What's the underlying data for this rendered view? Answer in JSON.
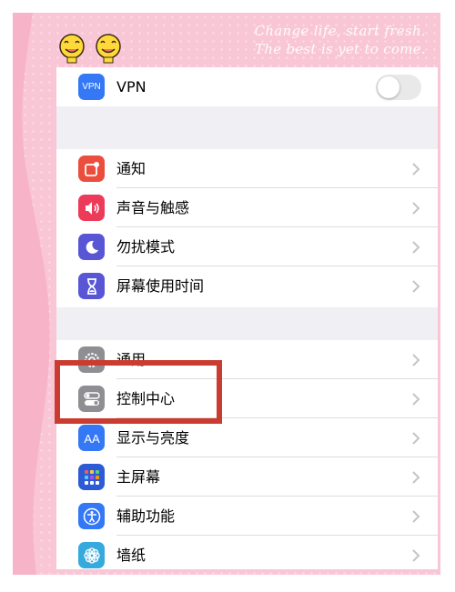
{
  "decoration": {
    "tagline_line1": "Change life, start fresh.",
    "tagline_line2": "The best is yet to come.",
    "emoji": "smiley-faces-icon",
    "highlight_color": "#c93c2f"
  },
  "settings": {
    "vpn": {
      "label": "VPN",
      "icon_text": "VPN",
      "icon": "vpn-icon",
      "toggle_on": false
    },
    "group2": [
      {
        "label": "通知",
        "icon": "notifications-icon",
        "color": "#ec4e3d"
      },
      {
        "label": "声音与触感",
        "icon": "sounds-icon",
        "color": "#ec3b59"
      },
      {
        "label": "勿扰模式",
        "icon": "moon-icon",
        "color": "#5956d6"
      },
      {
        "label": "屏幕使用时间",
        "icon": "hourglass-icon",
        "color": "#5956d6"
      }
    ],
    "group3": [
      {
        "label": "通用",
        "icon": "gear-icon",
        "color": "#8e8e93"
      },
      {
        "label": "控制中心",
        "icon": "control-center-icon",
        "color": "#8e8e93"
      },
      {
        "label": "显示与亮度",
        "icon": "display-icon",
        "color": "#3478f6"
      },
      {
        "label": "主屏幕",
        "icon": "home-screen-icon",
        "color": "#3478f6"
      },
      {
        "label": "辅助功能",
        "icon": "accessibility-icon",
        "color": "#3478f6"
      },
      {
        "label": "墙纸",
        "icon": "wallpaper-icon",
        "color": "#36aadc"
      }
    ]
  }
}
